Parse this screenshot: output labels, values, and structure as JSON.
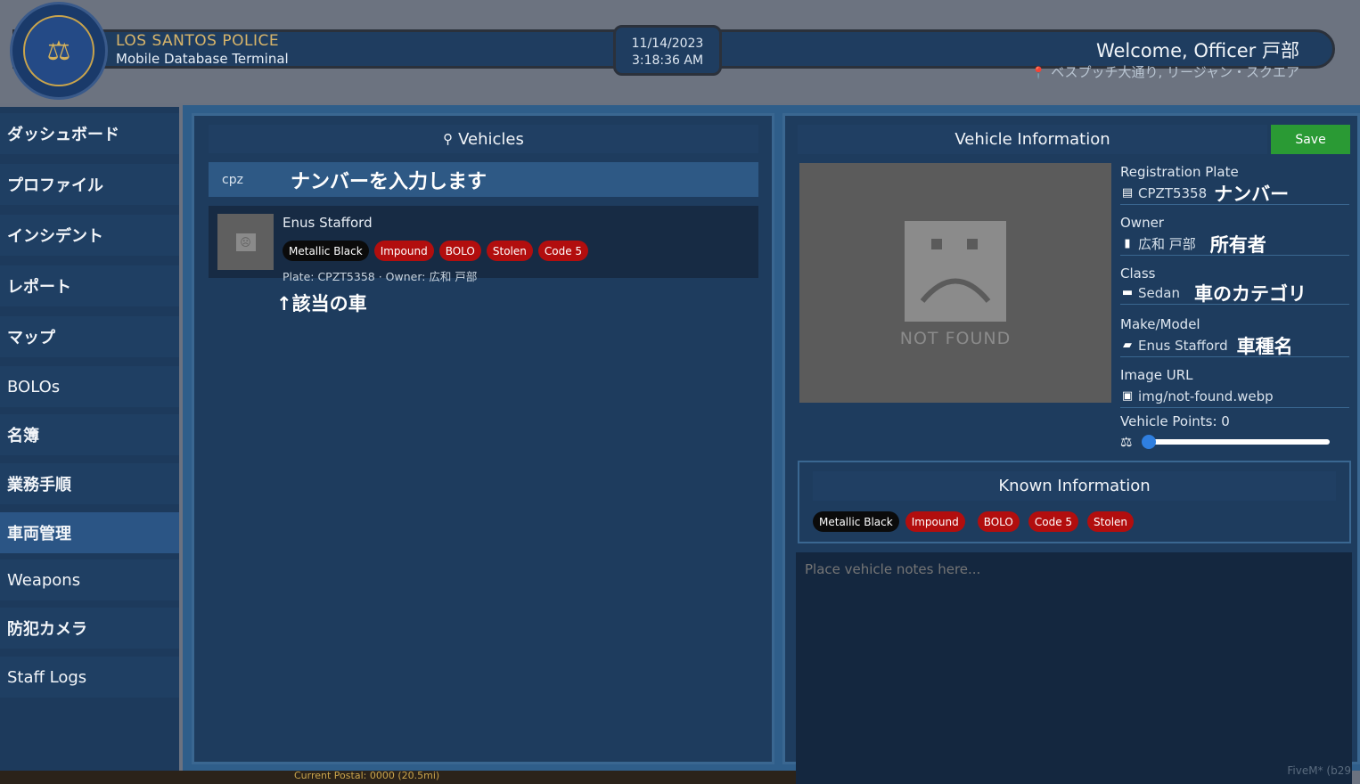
{
  "header": {
    "org_name": "LOS SANTOS POLICE",
    "org_sub": "Mobile Database Terminal",
    "date": "11/14/2023",
    "time": "3:18:36 AM",
    "welcome": "Welcome, Officer 戸部",
    "location": "ベスプッチ大通り, リージャン・スクエア"
  },
  "sidebar": {
    "items": [
      {
        "label": "ダッシュボード"
      },
      {
        "label": "プロファイル"
      },
      {
        "label": "インシデント"
      },
      {
        "label": "レポート"
      },
      {
        "label": "マップ"
      },
      {
        "label": "BOLOs"
      },
      {
        "label": "名簿"
      },
      {
        "label": "業務手順"
      },
      {
        "label": "車両管理"
      },
      {
        "label": "Weapons"
      },
      {
        "label": "防犯カメラ"
      },
      {
        "label": "Staff Logs"
      }
    ],
    "active_label": "車両管理"
  },
  "vehicles_panel": {
    "title": "Vehicles",
    "search_value": "cpz",
    "search_annotation": "ナンバーを入力します",
    "result": {
      "name": "Enus Stafford",
      "tags": [
        "Metallic Black",
        "Impound",
        "BOLO",
        "Stolen",
        "Code 5"
      ],
      "meta": "Plate: CPZT5358 · Owner: 広和 戸部",
      "annotation": "↑該当の車"
    }
  },
  "info_panel": {
    "title": "Vehicle Information",
    "save_label": "Save",
    "image_text": "NOT FOUND",
    "fields": {
      "plate_label": "Registration Plate",
      "plate_value": "CPZT5358",
      "plate_annotation": "ナンバー",
      "owner_label": "Owner",
      "owner_value": "広和 戸部",
      "owner_annotation": "所有者",
      "class_label": "Class",
      "class_value": "Sedan",
      "class_annotation": "車のカテゴリ",
      "make_label": "Make/Model",
      "make_value": "Enus Stafford",
      "make_annotation": "車種名",
      "image_label": "Image URL",
      "image_value": "img/not-found.webp",
      "points_label": "Vehicle Points: 0",
      "points_value": 0
    },
    "known_title": "Known Information",
    "known_tags": [
      "Metallic Black",
      "Impound",
      "BOLO",
      "Code 5",
      "Stolen"
    ],
    "notes_placeholder": "Place vehicle notes here...",
    "notes_value": ""
  },
  "footer": {
    "bottom_text": "Current Postal: 0000 (20.5mi)",
    "watermark": "FiveM* (b29"
  },
  "colors": {
    "accent": "#2b5585",
    "save": "#2a9a34",
    "tag_red": "#b20e0e",
    "tag_dark": "#0b0b0b"
  },
  "icons": [
    "search-icon",
    "id-card-icon",
    "bookmark-icon",
    "folder-icon",
    "car-icon",
    "image-icon",
    "scale-icon",
    "pin-icon"
  ]
}
